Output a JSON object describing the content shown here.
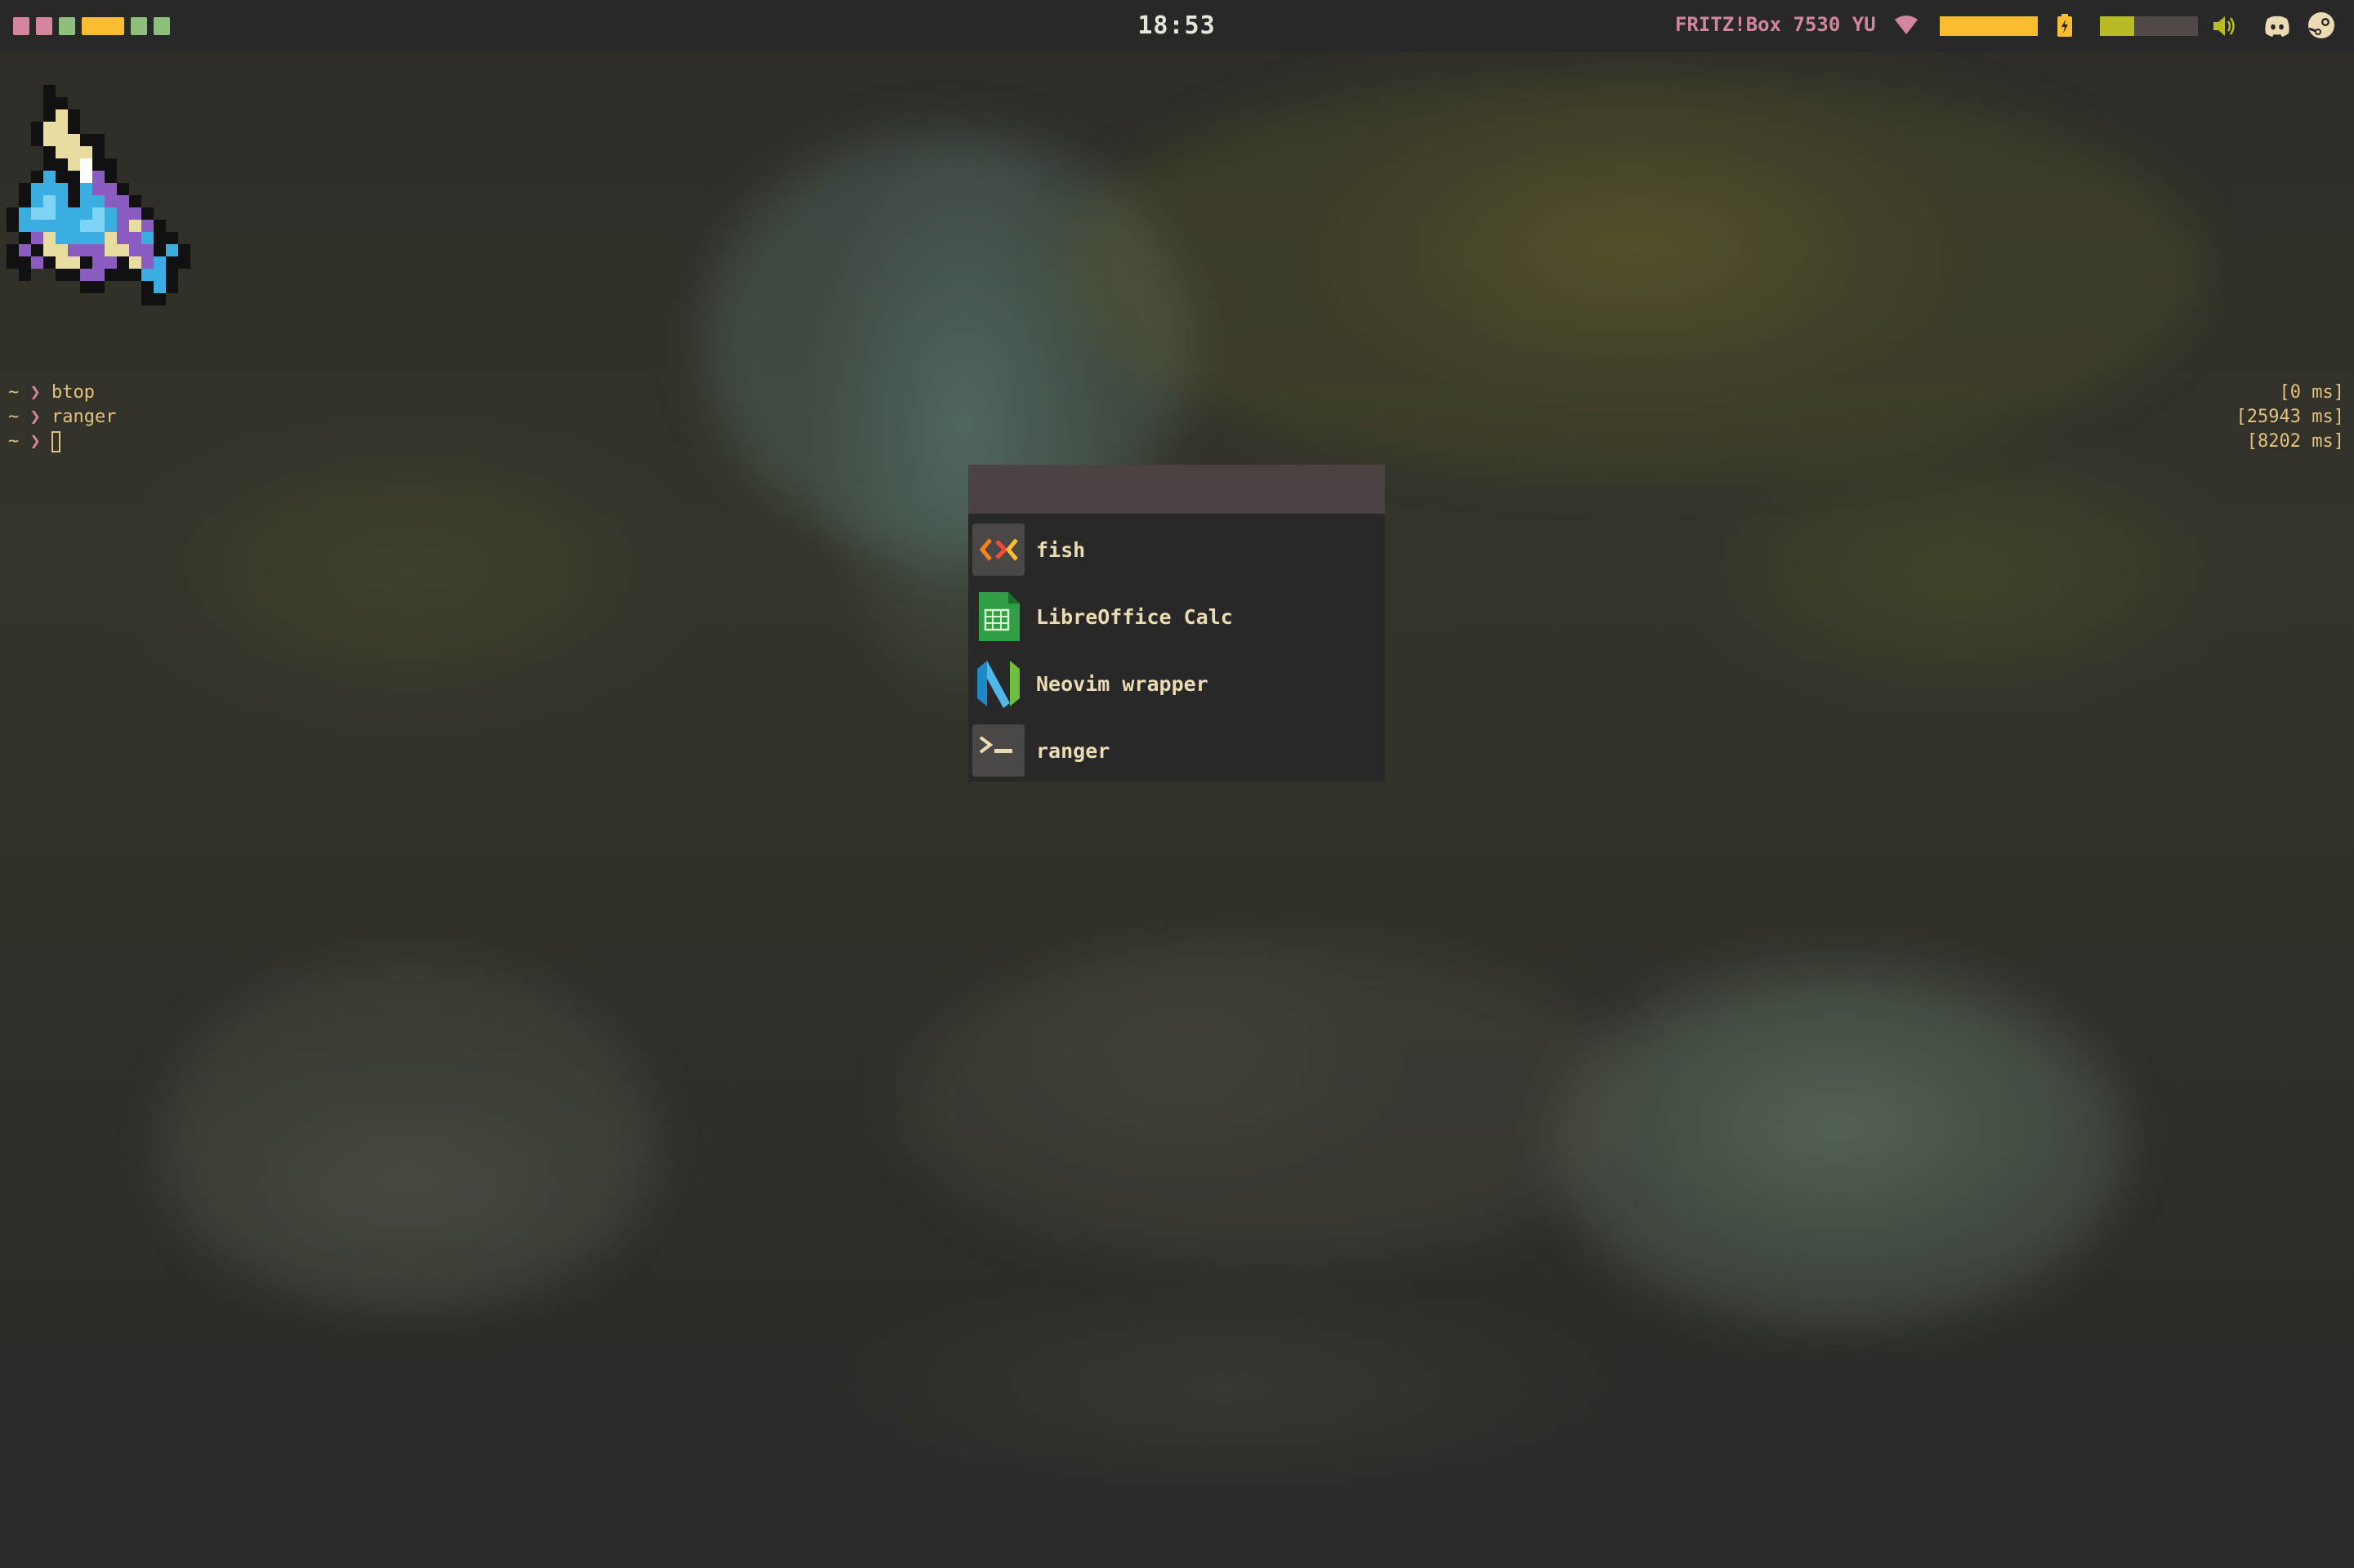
{
  "bar": {
    "workspaces": [
      {
        "name": "workspace-1",
        "color": "#d3869b"
      },
      {
        "name": "workspace-2",
        "color": "#d3869b"
      },
      {
        "name": "workspace-3",
        "color": "#8ec07c"
      },
      {
        "name": "workspace-4",
        "color": "#fabd2f",
        "active": true
      },
      {
        "name": "workspace-5",
        "color": "#8ec07c"
      },
      {
        "name": "workspace-6",
        "color": "#8ec07c"
      }
    ],
    "clock": "18:53",
    "network": "FRITZ!Box 7530 YU",
    "battery_level": 1.0,
    "volume_level": 0.35,
    "icons": [
      "wifi-icon",
      "charging-icon",
      "speaker-icon",
      "discord-icon",
      "steam-icon"
    ],
    "colors": {
      "network": "#d3869b",
      "battery": "#fabd2f",
      "volume": "#b8bb26"
    }
  },
  "terminal": {
    "lines": [
      {
        "tilde": "~",
        "prompt": "❯",
        "command": "btop",
        "timing": "[0 ms]"
      },
      {
        "tilde": "~",
        "prompt": "❯",
        "command": "ranger",
        "timing": "[25943 ms]"
      },
      {
        "tilde": "~",
        "prompt": "❯",
        "command": "",
        "timing": "[8202 ms]"
      }
    ]
  },
  "launcher": {
    "query": "",
    "entries": [
      {
        "name": "fish",
        "icon": "fish-icon"
      },
      {
        "name": "LibreOffice Calc",
        "icon": "libreoffice-calc-icon"
      },
      {
        "name": "Neovim wrapper",
        "icon": "neovim-icon"
      },
      {
        "name": "ranger",
        "icon": "terminal-icon"
      }
    ]
  }
}
